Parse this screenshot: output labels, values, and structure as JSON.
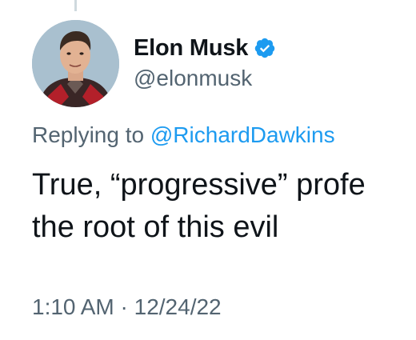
{
  "author": {
    "name": "Elon Musk",
    "handle": "@elonmusk",
    "verified": true
  },
  "reply": {
    "prefix": "Replying to ",
    "target": "@RichardDawkins"
  },
  "tweet": {
    "lines": [
      "True, “progressive” profe",
      "the root of this evil"
    ]
  },
  "meta": {
    "time": "1:10 AM",
    "separator": " · ",
    "date": "12/24/22"
  },
  "colors": {
    "text": "#0f1419",
    "secondary": "#536471",
    "link": "#1d9bf0",
    "verified": "#1d9bf0"
  },
  "icons": {
    "verified": "verified-badge-icon"
  }
}
